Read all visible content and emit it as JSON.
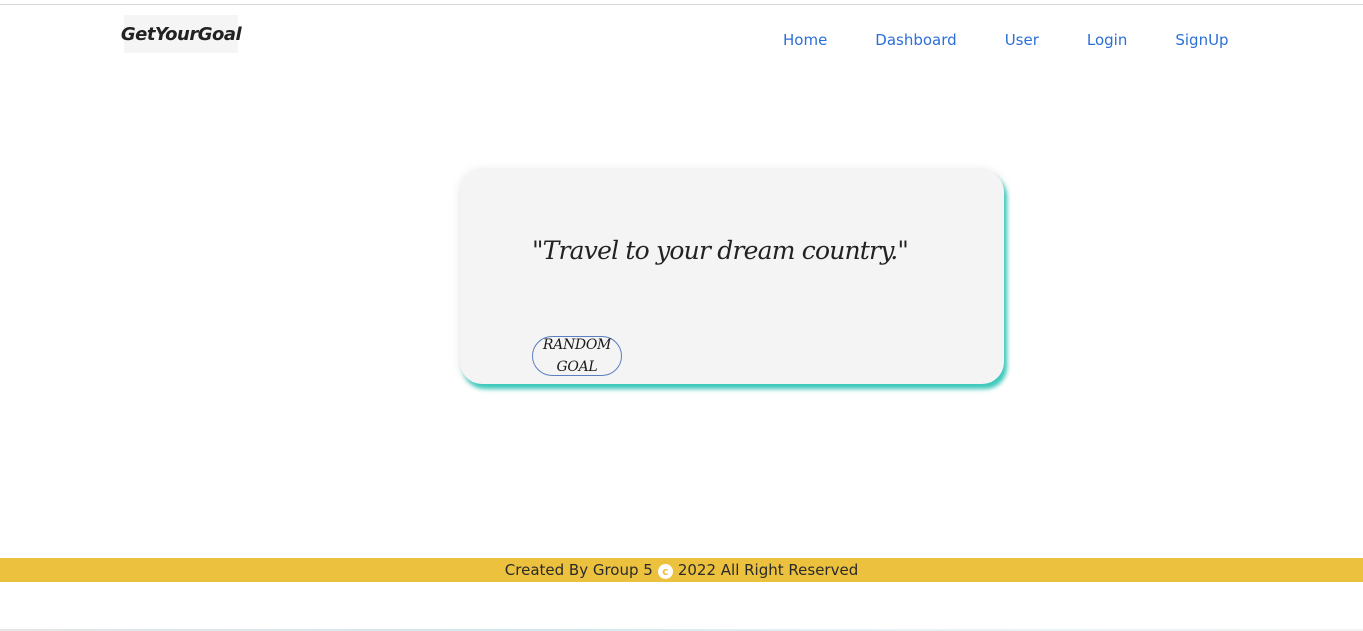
{
  "navbar": {
    "brand": "GetYourGoal",
    "links": [
      "Home",
      "Dashboard",
      "User",
      "Login",
      "SignUp"
    ]
  },
  "card": {
    "quote": "\"Travel to your dream country.\"",
    "button_line1": "RANDOM",
    "button_line2": "GOAL"
  },
  "footer": {
    "text_before": "Created By Group 5",
    "icon_glyph": "c",
    "text_after": "2022 All Right Reserved"
  },
  "colors": {
    "nav_link": "#2c6fd6",
    "footer_bg": "#ecc13e",
    "card_shadow": "#3cc9bb",
    "card_bg": "#f4f4f4"
  }
}
